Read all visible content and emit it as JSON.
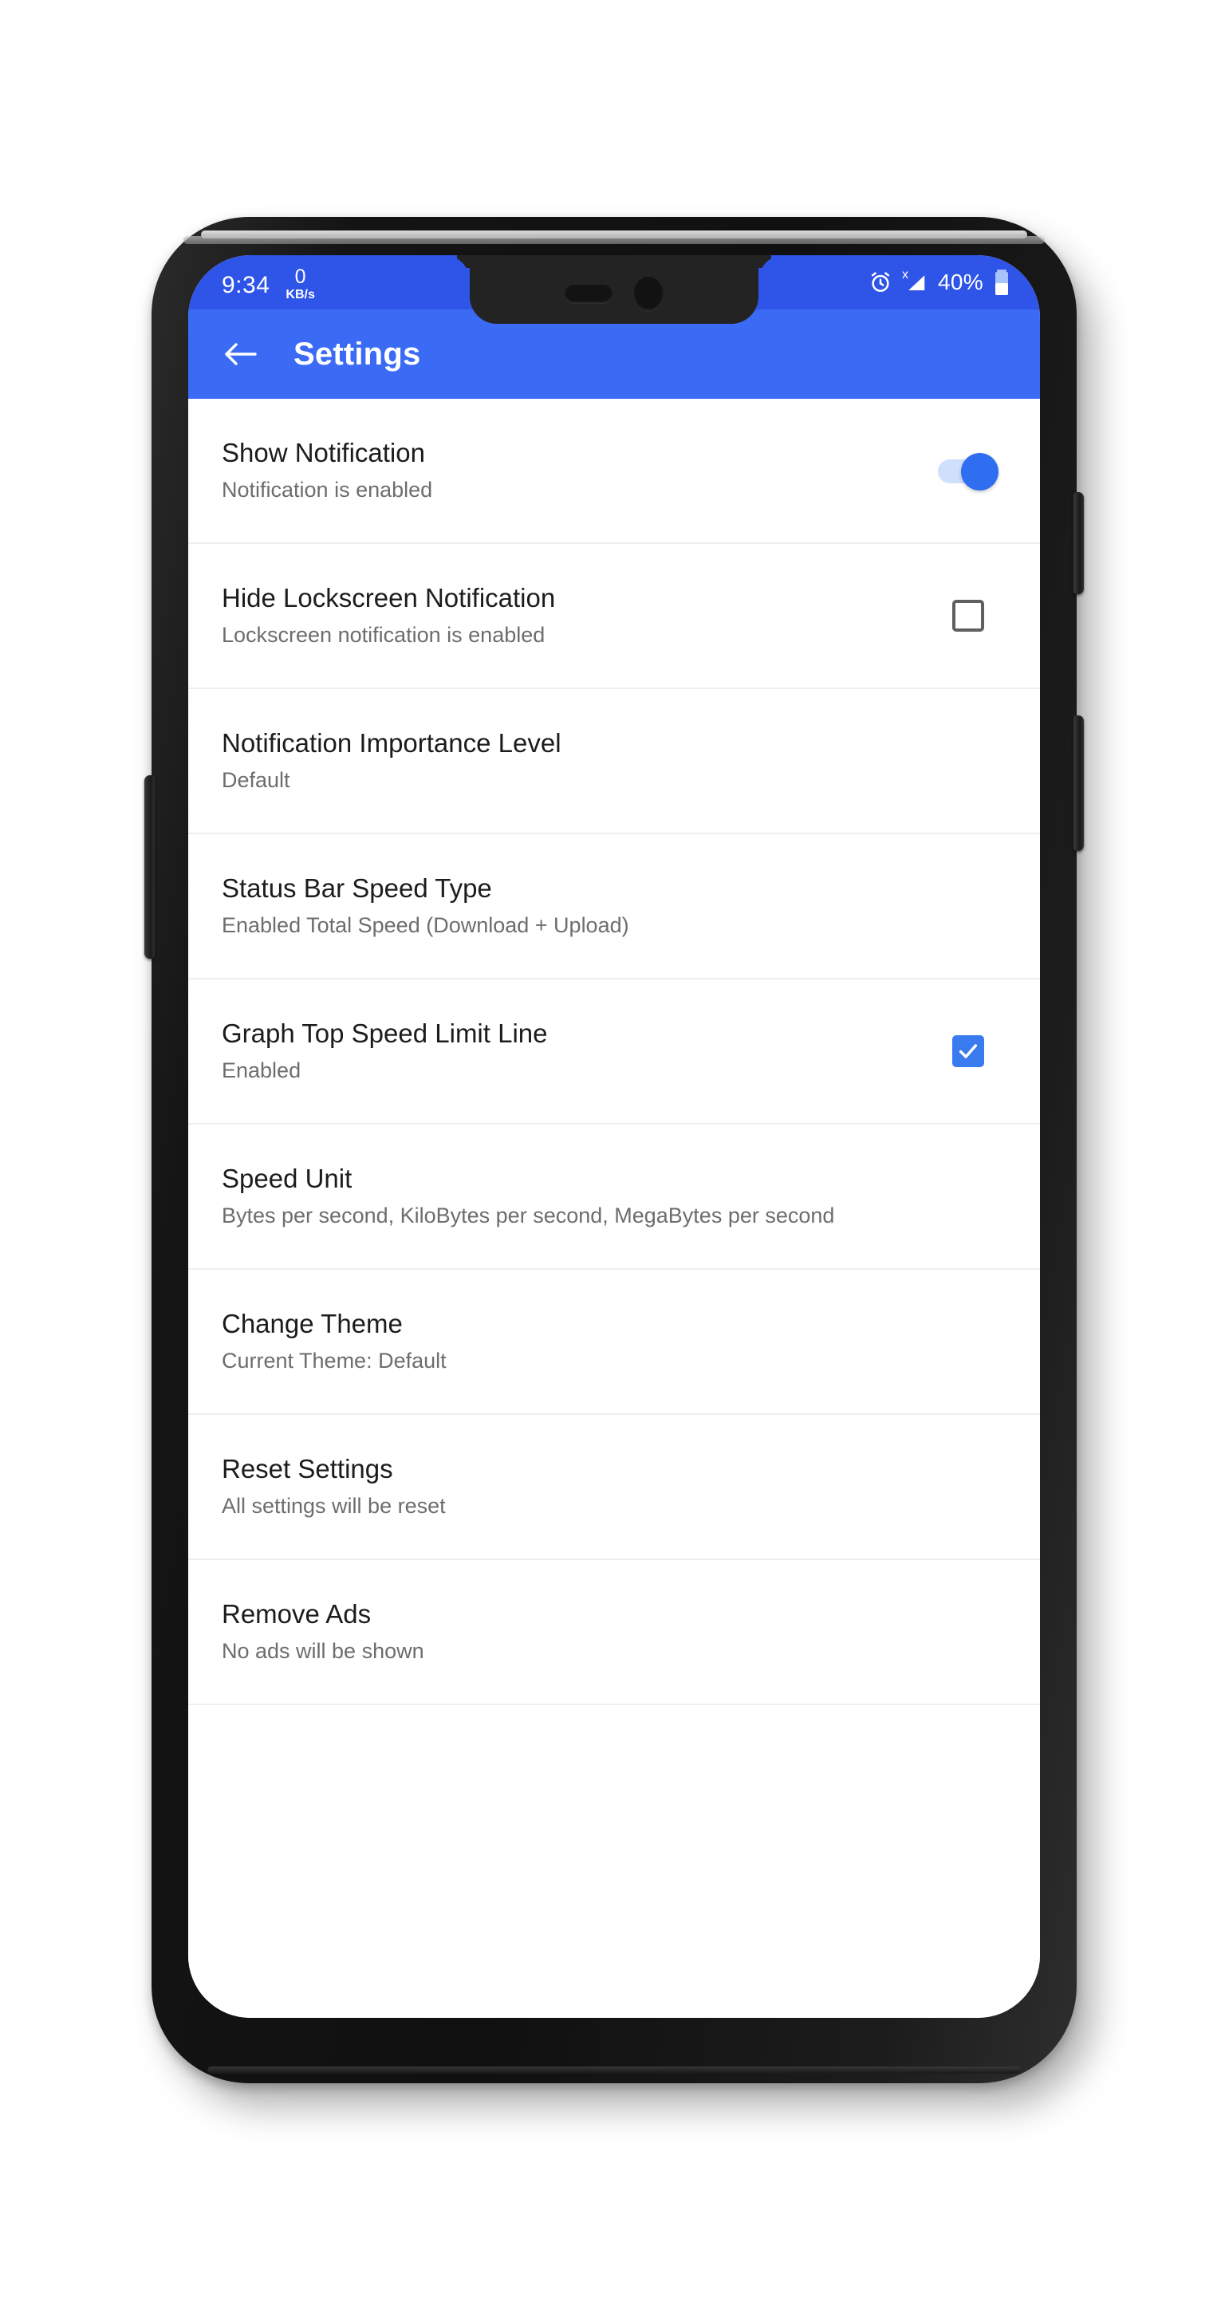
{
  "status_bar": {
    "clock": "9:34",
    "net_speed_value": "0",
    "net_speed_unit": "KB/s",
    "alarm_icon": "alarm-clock-icon",
    "signal_icon": "signal-strength-icon",
    "signal_superscript": "x",
    "battery_percent": "40%",
    "battery_icon": "battery-icon"
  },
  "app_bar": {
    "back_icon": "back-arrow-icon",
    "title": "Settings",
    "background_color": "#3b6bf5"
  },
  "theme": {
    "accent_color": "#3b7bf0",
    "status_bar_color": "#2f54e8",
    "toggle_on_color": "#2f6ef0",
    "toggle_track_color": "#cfe0fd"
  },
  "settings": [
    {
      "title": "Show Notification",
      "subtitle": "Notification is enabled",
      "control": "switch",
      "state": "on",
      "name": "show-notification"
    },
    {
      "title": "Hide Lockscreen Notification",
      "subtitle": "Lockscreen notification is enabled",
      "control": "checkbox",
      "state": "unchecked",
      "name": "hide-lockscreen-notification"
    },
    {
      "title": "Notification Importance Level",
      "subtitle": "Default",
      "control": "none",
      "state": "",
      "name": "notification-importance-level"
    },
    {
      "title": "Status Bar Speed Type",
      "subtitle": "Enabled Total Speed (Download + Upload)",
      "control": "none",
      "state": "",
      "name": "status-bar-speed-type"
    },
    {
      "title": "Graph Top Speed Limit Line",
      "subtitle": "Enabled",
      "control": "checkbox",
      "state": "checked",
      "name": "graph-top-speed-limit-line"
    },
    {
      "title": "Speed Unit",
      "subtitle": "Bytes per second, KiloBytes per second, MegaBytes per second",
      "control": "none",
      "state": "",
      "name": "speed-unit"
    },
    {
      "title": "Change Theme",
      "subtitle": "Current Theme: Default",
      "control": "none",
      "state": "",
      "name": "change-theme"
    },
    {
      "title": "Reset Settings",
      "subtitle": "All settings will be reset",
      "control": "none",
      "state": "",
      "name": "reset-settings"
    },
    {
      "title": "Remove Ads",
      "subtitle": "No ads will be shown",
      "control": "none",
      "state": "",
      "name": "remove-ads"
    }
  ]
}
